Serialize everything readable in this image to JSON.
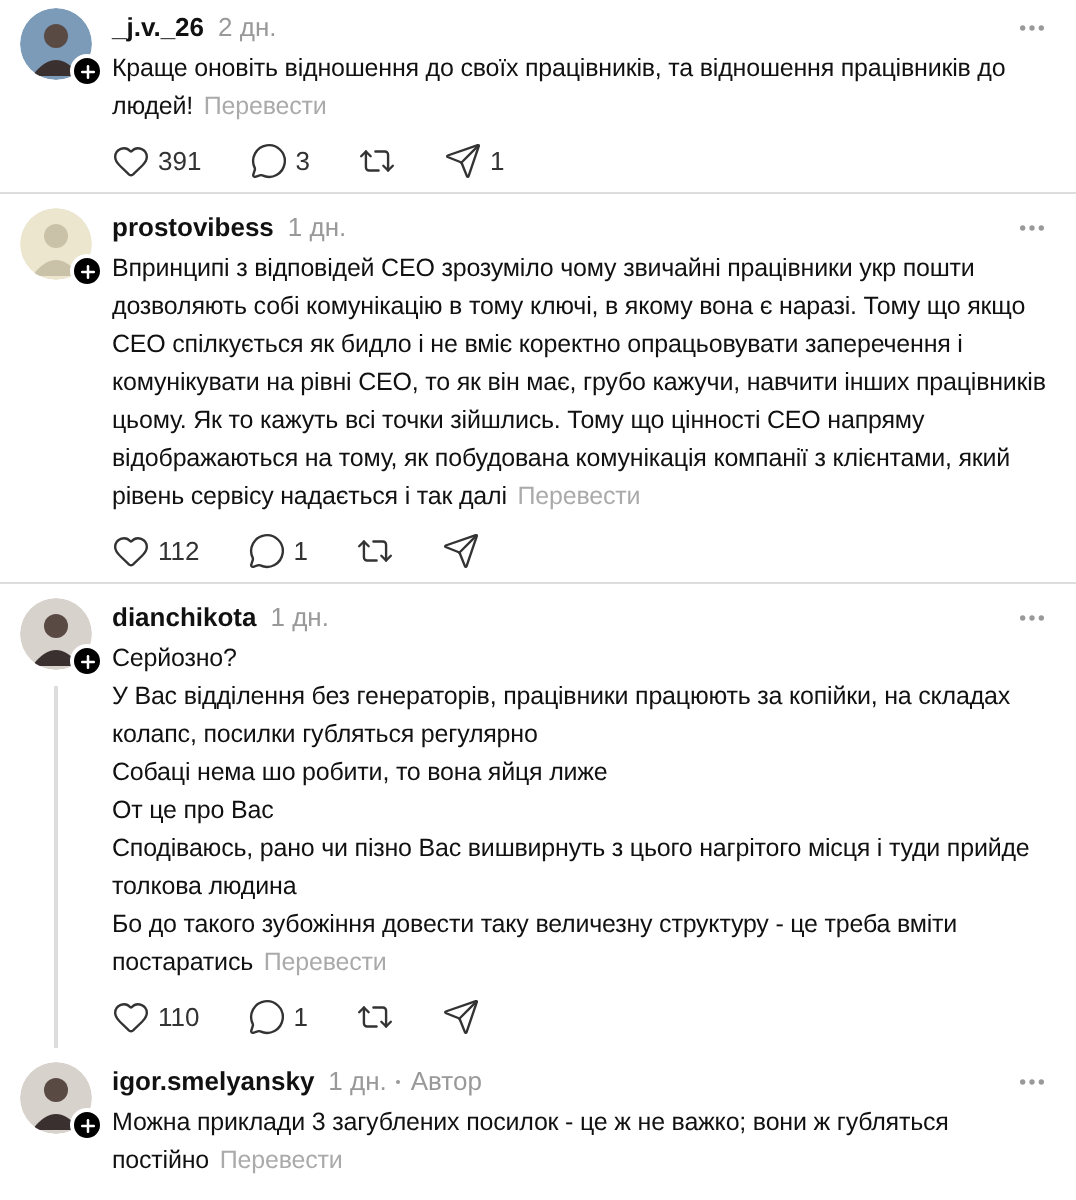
{
  "comments": [
    {
      "username": "_j.v._26",
      "time": "2 дн.",
      "paragraphs": [
        "Краще оновіть відношення до своїх працівників, та відношення працівників до людей!"
      ],
      "translate": "Перевести",
      "likes": "391",
      "replies": "3",
      "shares": "1",
      "reply_line": false
    },
    {
      "username": "prostovibess",
      "time": "1 дн.",
      "paragraphs": [
        "Впринципі з відповідей CEO зрозуміло чому звичайні працівники укр пошти дозволяють собі комунікацію в тому ключі, в якому вона є наразі. Тому що якщо CEO спілкується як бидло і не вміє коректно опрацьовувати заперечення і комунікувати на рівні CEO, то як він має, грубо кажучи, навчити інших працівників цьому. Як то кажуть всі точки зійшлись. Тому що цінності CEO напряму відображаються на тому, як побудована комунікація компанії з клієнтами, який рівень сервісу надається і так далі"
      ],
      "translate": "Перевести",
      "likes": "112",
      "replies": "1",
      "reply_line": false
    },
    {
      "username": "dianchikota",
      "time": "1 дн.",
      "paragraphs": [
        "Серйозно?",
        "У Вас відділення без генераторів, працівники працюють за копійки, на складах колапс, посилки губляться регулярно",
        "Собаці нема шо робити, то вона яйця лиже",
        "От це про Вас",
        "Сподіваюсь, рано чи пізно Вас вишвирнуть з цього нагрітого місця і туди прийде толкова людина",
        "Бо до такого зубожіння довести таку величезну структуру - це треба вміти постаратись"
      ],
      "translate": "Перевести",
      "likes": "110",
      "replies": "1",
      "reply_line": true
    },
    {
      "username": "igor.smelyansky",
      "time": "1 дн.",
      "author_label": "Автор",
      "paragraphs": [
        "Можна приклади 3 загублених посилок - це ж не важко; вони ж губляться постійно"
      ],
      "translate": "Перевести",
      "reply_line": false
    }
  ]
}
